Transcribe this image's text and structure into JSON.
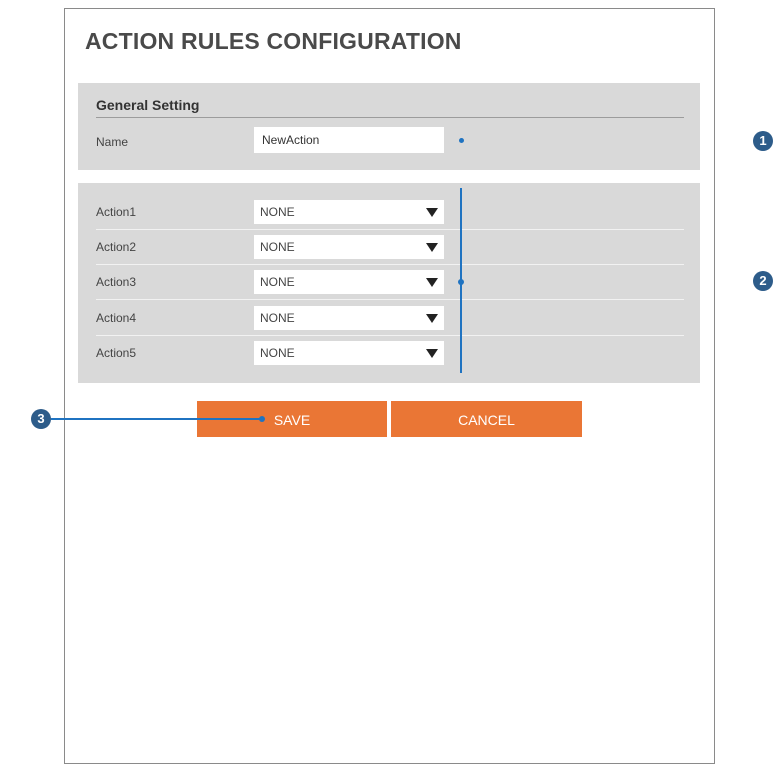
{
  "page": {
    "title": "ACTION RULES CONFIGURATION"
  },
  "general": {
    "section_title": "General Setting",
    "name_label": "Name",
    "name_value": "NewAction"
  },
  "actions": [
    {
      "label": "Action1",
      "value": "NONE"
    },
    {
      "label": "Action2",
      "value": "NONE"
    },
    {
      "label": "Action3",
      "value": "NONE"
    },
    {
      "label": "Action4",
      "value": "NONE"
    },
    {
      "label": "Action5",
      "value": "NONE"
    }
  ],
  "buttons": {
    "save_label": "SAVE",
    "cancel_label": "CANCEL"
  },
  "callouts": [
    "1",
    "2",
    "3"
  ],
  "colors": {
    "accent_button": "#ea7635",
    "callout_line": "#1f73c1",
    "panel_gray": "#d9d9d9",
    "callout_badge": "#2d5c8a"
  }
}
